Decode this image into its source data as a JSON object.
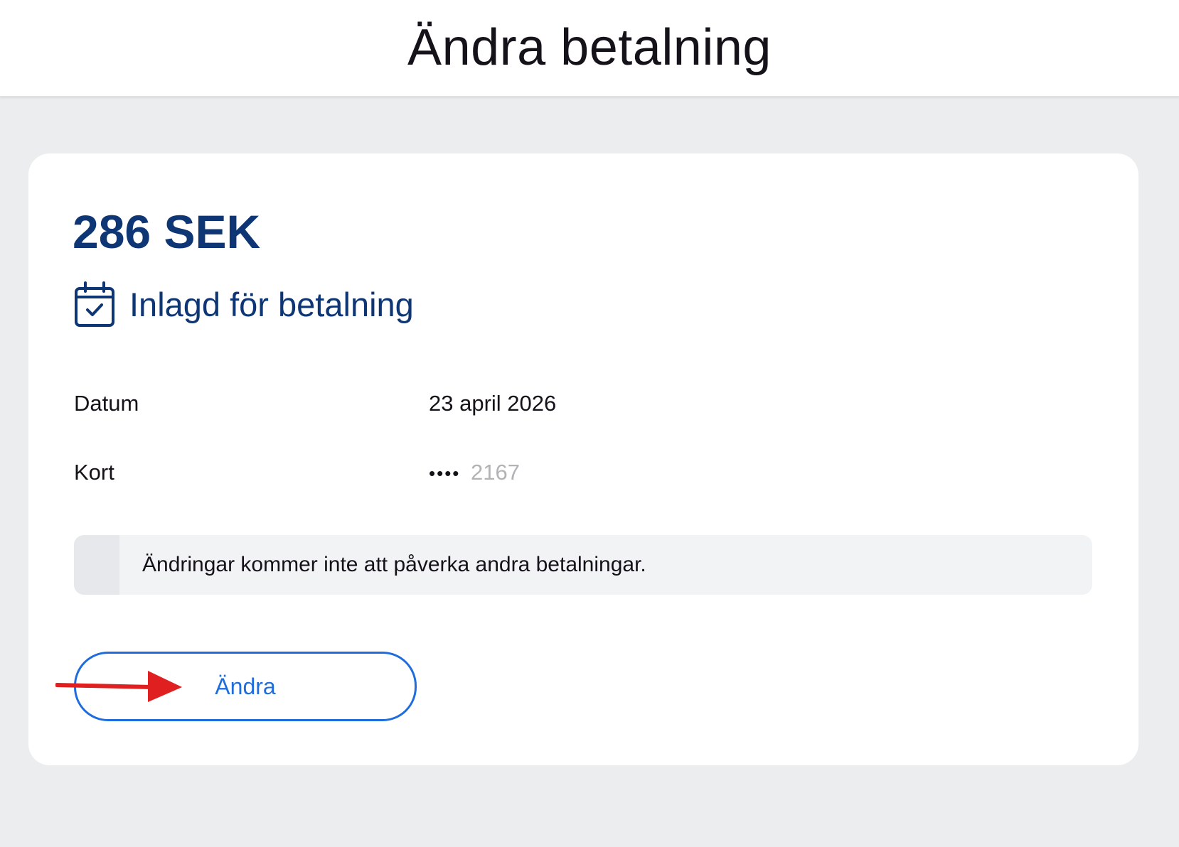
{
  "header": {
    "title": "Ändra betalning"
  },
  "payment": {
    "amount": "286 SEK",
    "status_icon": "calendar-check-icon",
    "status_text": "Inlagd för betalning",
    "details": {
      "date_label": "Datum",
      "date_value": "23 april 2026",
      "card_label": "Kort",
      "card_mask": "••••",
      "card_last4": "2167"
    },
    "notice_text": "Ändringar kommer inte att påverka andra betalningar.",
    "change_button_label": "Ändra"
  },
  "annotation": {
    "arrow_icon": "red-arrow-icon",
    "arrow_color": "#e02020"
  },
  "colors": {
    "brand_navy": "#0e3674",
    "button_blue": "#1f6ddc",
    "background": "#ecedef"
  }
}
